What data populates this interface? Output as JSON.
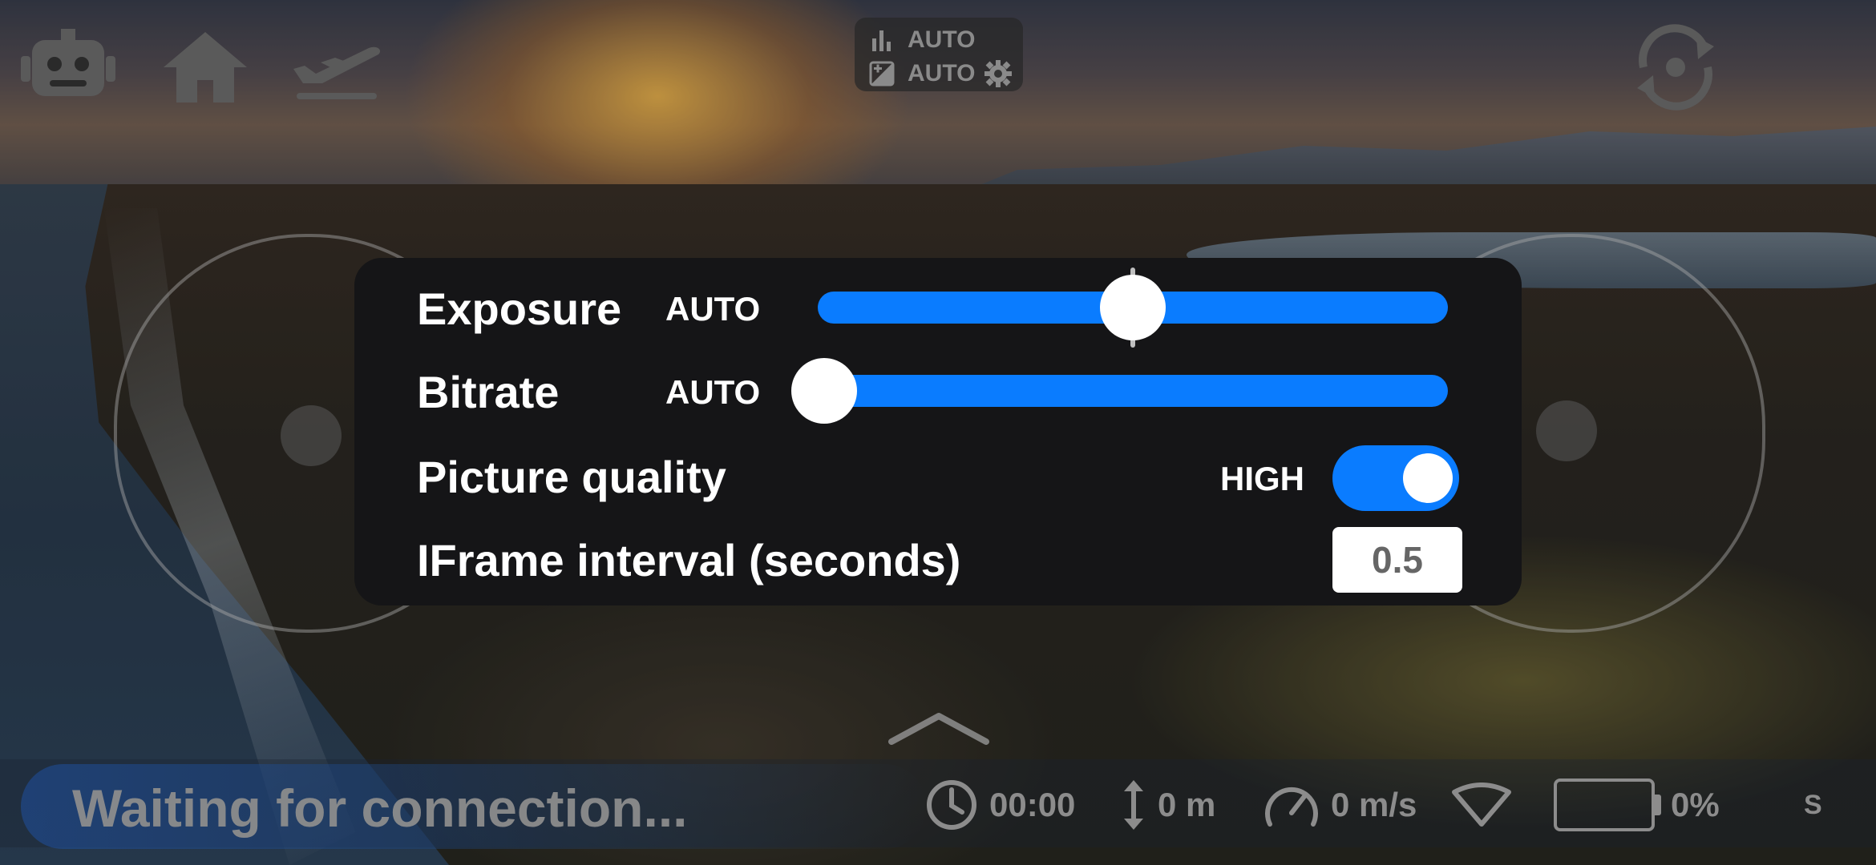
{
  "top_bar": {
    "icons": [
      "robot-icon",
      "home-icon",
      "plane-icon",
      "rotate-camera-icon",
      "record-button"
    ],
    "camera_modes": {
      "metering_label": "AUTO",
      "exposure_label": "AUTO"
    }
  },
  "settings": {
    "exposure": {
      "label": "Exposure",
      "mode": "AUTO",
      "value_fraction": 0.5
    },
    "bitrate": {
      "label": "Bitrate",
      "mode": "AUTO",
      "value_fraction": 0.0
    },
    "picture_quality": {
      "label": "Picture quality",
      "value": "HIGH",
      "enabled": true
    },
    "iframe_interval": {
      "label": "IFrame interval (seconds)",
      "value": "0.5"
    }
  },
  "status_bar": {
    "message": "Waiting for connection...",
    "time": "00:00",
    "altitude": "0 m",
    "speed": "0 m/s",
    "battery": "0%",
    "mode": "S"
  },
  "colors": {
    "accent": "#0a7cff",
    "panel": "#151517",
    "muted_icon": "#8c8c8c"
  }
}
